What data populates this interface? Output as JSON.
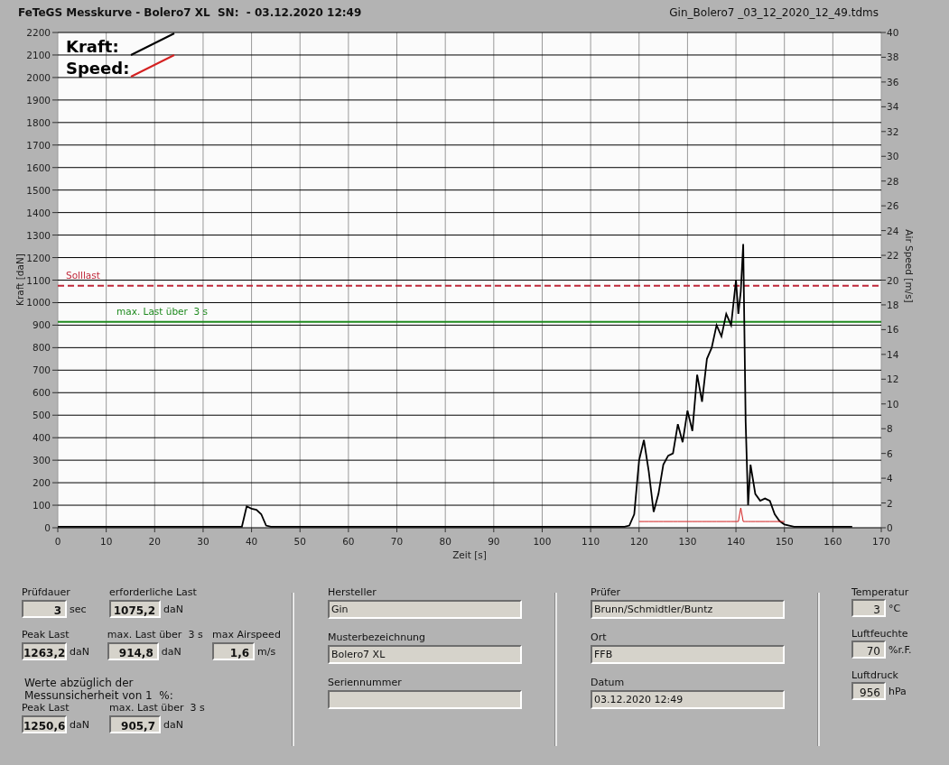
{
  "window": {
    "title": "FeTeGS Messkurve - Bolero7 XL  SN:  - 03.12.2020 12:49",
    "file": "Gin_Bolero7 _03_12_2020_12_49.tdms"
  },
  "chart": {
    "chart_data": {
      "type": "line",
      "xlabel": "Zeit [s]",
      "ylabel": "Kraft [daN]",
      "y2label": "Air Speed [m/s]",
      "x": [
        0,
        10,
        20,
        30,
        38,
        39,
        40,
        41,
        42,
        43,
        44,
        60,
        80,
        100,
        117,
        118,
        119,
        120,
        121,
        122,
        123,
        124,
        125,
        126,
        127,
        128,
        129,
        130,
        131,
        132,
        133,
        134,
        135,
        136,
        137,
        138,
        139,
        140,
        140.5,
        141,
        141.5,
        142,
        142.5,
        143,
        144,
        145,
        146,
        147,
        148,
        149,
        150,
        152,
        164,
        170
      ],
      "series": [
        {
          "name": "Kraft:",
          "color": "#000000",
          "values": [
            5,
            5,
            5,
            5,
            5,
            95,
            85,
            80,
            60,
            10,
            5,
            5,
            5,
            5,
            5,
            10,
            60,
            300,
            390,
            250,
            70,
            150,
            280,
            320,
            330,
            460,
            380,
            520,
            430,
            680,
            560,
            750,
            800,
            900,
            850,
            950,
            900,
            1100,
            950,
            1050,
            1260,
            470,
            100,
            280,
            150,
            120,
            130,
            120,
            60,
            30,
            15,
            5,
            5,
            null
          ]
        },
        {
          "name": "Speed:",
          "color": "#d42020",
          "axis": "y2",
          "values": [
            null,
            null,
            null,
            null,
            null,
            null,
            null,
            null,
            null,
            null,
            null,
            null,
            null,
            null,
            null,
            null,
            null,
            0.5,
            0.5,
            0.5,
            0.5,
            0.5,
            0.5,
            0.5,
            0.5,
            0.5,
            0.5,
            0.5,
            0.5,
            0.5,
            0.5,
            0.5,
            0.5,
            0.5,
            0.5,
            0.5,
            0.5,
            0.5,
            0.5,
            1.6,
            0.5,
            0.5,
            0.5,
            0.5,
            0.5,
            0.5,
            0.5,
            0.5,
            0.5,
            0.5,
            0.5,
            null,
            null,
            null
          ]
        },
        {
          "name": "Solllast",
          "color": "#c0283a",
          "line_style": "dashed",
          "values": [
            1075.2,
            1075.2,
            1075.2,
            1075.2,
            1075.2,
            1075.2,
            1075.2,
            1075.2,
            1075.2,
            1075.2,
            1075.2,
            1075.2,
            1075.2,
            1075.2,
            1075.2,
            1075.2,
            1075.2,
            1075.2,
            1075.2,
            1075.2,
            1075.2,
            1075.2,
            1075.2,
            1075.2,
            1075.2,
            1075.2,
            1075.2,
            1075.2,
            1075.2,
            1075.2,
            1075.2,
            1075.2,
            1075.2,
            1075.2,
            1075.2,
            1075.2,
            1075.2,
            1075.2,
            1075.2,
            1075.2,
            1075.2,
            1075.2,
            1075.2,
            1075.2,
            1075.2,
            1075.2,
            1075.2,
            1075.2,
            1075.2,
            1075.2,
            1075.2,
            1075.2,
            1075.2,
            1075.2
          ]
        },
        {
          "name": "max. Last über  3 s",
          "color": "#1e8a1e",
          "values": [
            914.8,
            914.8,
            914.8,
            914.8,
            914.8,
            914.8,
            914.8,
            914.8,
            914.8,
            914.8,
            914.8,
            914.8,
            914.8,
            914.8,
            914.8,
            914.8,
            914.8,
            914.8,
            914.8,
            914.8,
            914.8,
            914.8,
            914.8,
            914.8,
            914.8,
            914.8,
            914.8,
            914.8,
            914.8,
            914.8,
            914.8,
            914.8,
            914.8,
            914.8,
            914.8,
            914.8,
            914.8,
            914.8,
            914.8,
            914.8,
            914.8,
            914.8,
            914.8,
            914.8,
            914.8,
            914.8,
            914.8,
            914.8,
            914.8,
            914.8,
            914.8,
            914.8,
            914.8,
            914.8
          ]
        }
      ],
      "legend": true,
      "grid": true,
      "xlim": [
        0,
        170
      ],
      "ylim": [
        0,
        2200
      ],
      "y2lim": [
        0,
        40
      ],
      "xticks": [
        0,
        10,
        20,
        30,
        40,
        50,
        60,
        70,
        80,
        90,
        100,
        110,
        120,
        130,
        140,
        150,
        160,
        170
      ],
      "yticks": [
        0,
        100,
        200,
        300,
        400,
        500,
        600,
        700,
        800,
        900,
        1000,
        1100,
        1200,
        1300,
        1400,
        1500,
        1600,
        1700,
        1800,
        1900,
        2000,
        2100,
        2200
      ],
      "y2ticks": [
        0,
        2,
        4,
        6,
        8,
        10,
        12,
        14,
        16,
        18,
        20,
        22,
        24,
        26,
        28,
        30,
        32,
        34,
        36,
        38,
        40
      ]
    }
  },
  "results": [
    [
      {
        "label": "Prüfdauer",
        "value": "3",
        "unit": "sec"
      },
      {
        "label": "erforderliche Last",
        "value": "1075,2",
        "unit": "daN"
      }
    ],
    [
      {
        "label": "Peak Last",
        "value": "1263,2",
        "unit": "daN"
      },
      {
        "label": "max. Last über  3 s",
        "value": "914,8",
        "unit": "daN"
      },
      {
        "label": "max Airspeed",
        "value": "1,6",
        "unit": "m/s"
      }
    ]
  ],
  "note": "Werte abzüglich der Messunsicherheit von 1  %:",
  "corrected_results": [
    {
      "label": "Peak Last",
      "value": "1250,6",
      "unit": "daN"
    },
    {
      "label": "max. Last über  3 s",
      "value": "905,7",
      "unit": "daN"
    }
  ],
  "specimen": [
    {
      "label": "Hersteller",
      "value": "Gin"
    },
    {
      "label": "Musterbezeichnung",
      "value": "Bolero7 XL"
    },
    {
      "label": "Seriennummer"
    }
  ],
  "test_info": [
    {
      "label": "Prüfer",
      "value": "Brunn/Schmidtler/Buntz"
    },
    {
      "label": "Ort",
      "value": "FFB"
    },
    {
      "label": "Datum",
      "value": "03.12.2020 12:49"
    }
  ],
  "conditions": [
    {
      "label": "Temperatur",
      "value": "3",
      "unit": "°C"
    },
    {
      "label": "Luftfeuchte",
      "value": "70",
      "unit": "%r.F."
    },
    {
      "label": "Luftdruck",
      "value": "956",
      "unit": "hPa"
    }
  ]
}
